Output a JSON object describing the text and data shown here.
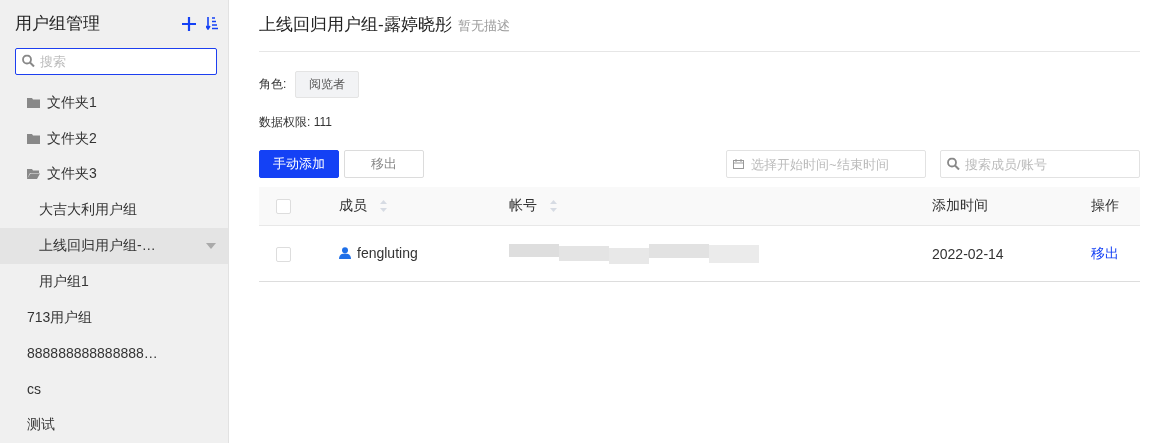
{
  "sidebar": {
    "title": "用户组管理",
    "search": {
      "placeholder": "搜索"
    },
    "tree": [
      {
        "kind": "folder",
        "label": "文件夹1",
        "expanded": false,
        "selected": false
      },
      {
        "kind": "folder",
        "label": "文件夹2",
        "expanded": false,
        "selected": false
      },
      {
        "kind": "folder",
        "label": "文件夹3",
        "expanded": true,
        "selected": false,
        "children": [
          {
            "kind": "group",
            "label": "大吉大利用户组",
            "selected": false
          },
          {
            "kind": "group",
            "label": "上线回归用户组-…",
            "selected": true
          },
          {
            "kind": "group",
            "label": "用户组1",
            "selected": false
          }
        ]
      },
      {
        "kind": "group",
        "label": "713用户组",
        "selected": false
      },
      {
        "kind": "group",
        "label": "888888888888888…",
        "selected": false
      },
      {
        "kind": "group",
        "label": "cs",
        "selected": false
      },
      {
        "kind": "group",
        "label": "测试",
        "selected": false
      }
    ]
  },
  "detail": {
    "title": "上线回归用户组-露婷晓彤",
    "description": "暂无描述",
    "role_label": "角色:",
    "role": "阅览者",
    "data_permission": "数据权限: 111",
    "buttons": [
      {
        "label": "手动添加",
        "kind": "primary"
      },
      {
        "label": "移出",
        "kind": "default"
      }
    ],
    "date_range": {
      "placeholder": "选择开始时间~结束时间"
    },
    "member_search": {
      "placeholder": "搜索成员/账号"
    },
    "table": {
      "select_all": false,
      "columns": [
        {
          "label": "成员",
          "sortable": true
        },
        {
          "label": "帐号",
          "sortable": true
        },
        {
          "label": "添加时间",
          "sortable": false
        },
        {
          "label": "操作",
          "sortable": false
        }
      ],
      "rows": [
        {
          "checked": false,
          "member": "fengluting",
          "added": "2022-02-14",
          "action": "移出"
        }
      ]
    }
  }
}
